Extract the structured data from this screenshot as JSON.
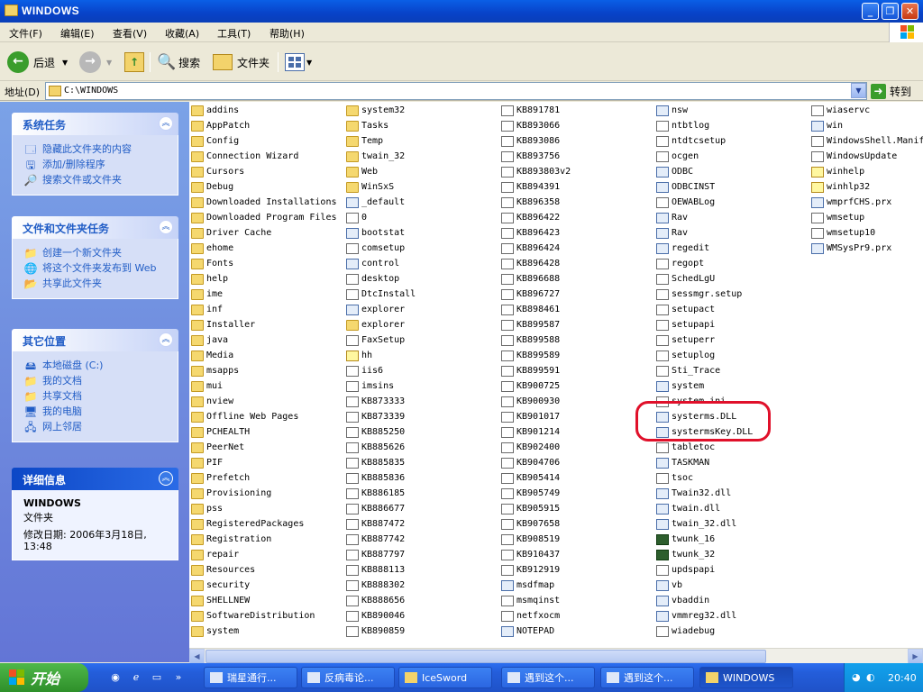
{
  "window": {
    "title": "WINDOWS"
  },
  "menu": [
    "文件(F)",
    "编辑(E)",
    "查看(V)",
    "收藏(A)",
    "工具(T)",
    "帮助(H)"
  ],
  "toolbar": {
    "back": "后退",
    "search": "搜索",
    "folders": "文件夹"
  },
  "address": {
    "label": "地址(D)",
    "value": "C:\\WINDOWS",
    "go": "转到"
  },
  "panels": {
    "system_tasks": {
      "title": "系统任务",
      "items": [
        "隐藏此文件夹的内容",
        "添加/删除程序",
        "搜索文件或文件夹"
      ]
    },
    "file_tasks": {
      "title": "文件和文件夹任务",
      "items": [
        "创建一个新文件夹",
        "将这个文件夹发布到 Web",
        "共享此文件夹"
      ]
    },
    "other_places": {
      "title": "其它位置",
      "items": [
        "本地磁盘 (C:)",
        "我的文档",
        "共享文档",
        "我的电脑",
        "网上邻居"
      ]
    },
    "details": {
      "title": "详细信息",
      "name": "WINDOWS",
      "type": "文件夹",
      "modified": "修改日期: 2006年3月18日, 13:48"
    }
  },
  "files": {
    "col1": [
      {
        "n": "addins",
        "t": "folder"
      },
      {
        "n": "AppPatch",
        "t": "folder"
      },
      {
        "n": "Config",
        "t": "folder"
      },
      {
        "n": "Connection Wizard",
        "t": "folder"
      },
      {
        "n": "Cursors",
        "t": "folder"
      },
      {
        "n": "Debug",
        "t": "folder"
      },
      {
        "n": "Downloaded Installations",
        "t": "folder"
      },
      {
        "n": "Downloaded Program Files",
        "t": "folder"
      },
      {
        "n": "Driver Cache",
        "t": "folder"
      },
      {
        "n": "ehome",
        "t": "folder"
      },
      {
        "n": "Fonts",
        "t": "folder"
      },
      {
        "n": "help",
        "t": "folder"
      },
      {
        "n": "ime",
        "t": "folder"
      },
      {
        "n": "inf",
        "t": "folder"
      },
      {
        "n": "Installer",
        "t": "folder"
      },
      {
        "n": "java",
        "t": "folder"
      },
      {
        "n": "Media",
        "t": "folder"
      },
      {
        "n": "msapps",
        "t": "folder"
      },
      {
        "n": "mui",
        "t": "folder"
      },
      {
        "n": "nview",
        "t": "folder"
      },
      {
        "n": "Offline Web Pages",
        "t": "folder"
      },
      {
        "n": "PCHEALTH",
        "t": "folder"
      },
      {
        "n": "PeerNet",
        "t": "folder"
      },
      {
        "n": "PIF",
        "t": "folder"
      },
      {
        "n": "Prefetch",
        "t": "folder"
      },
      {
        "n": "Provisioning",
        "t": "folder"
      },
      {
        "n": "pss",
        "t": "folder"
      },
      {
        "n": "RegisteredPackages",
        "t": "folder"
      },
      {
        "n": "Registration",
        "t": "folder"
      },
      {
        "n": "repair",
        "t": "folder"
      },
      {
        "n": "Resources",
        "t": "folder"
      },
      {
        "n": "security",
        "t": "folder"
      },
      {
        "n": "SHELLNEW",
        "t": "folder"
      },
      {
        "n": "SoftwareDistribution",
        "t": "folder"
      },
      {
        "n": "system",
        "t": "folder"
      }
    ],
    "col2": [
      {
        "n": "system32",
        "t": "folder"
      },
      {
        "n": "Tasks",
        "t": "folder"
      },
      {
        "n": "Temp",
        "t": "folder"
      },
      {
        "n": "twain_32",
        "t": "folder"
      },
      {
        "n": "Web",
        "t": "folder"
      },
      {
        "n": "WinSxS",
        "t": "folder"
      },
      {
        "n": "_default",
        "t": "exe"
      },
      {
        "n": "0",
        "t": "file"
      },
      {
        "n": "bootstat",
        "t": "exe"
      },
      {
        "n": "comsetup",
        "t": "file"
      },
      {
        "n": "control",
        "t": "exe"
      },
      {
        "n": "desktop",
        "t": "file"
      },
      {
        "n": "DtcInstall",
        "t": "file"
      },
      {
        "n": "explorer",
        "t": "exe"
      },
      {
        "n": "explorer",
        "t": "folder"
      },
      {
        "n": "FaxSetup",
        "t": "file"
      },
      {
        "n": "hh",
        "t": "help"
      },
      {
        "n": "iis6",
        "t": "file"
      },
      {
        "n": "imsins",
        "t": "file"
      },
      {
        "n": "KB873333",
        "t": "file"
      },
      {
        "n": "KB873339",
        "t": "file"
      },
      {
        "n": "KB885250",
        "t": "file"
      },
      {
        "n": "KB885626",
        "t": "file"
      },
      {
        "n": "KB885835",
        "t": "file"
      },
      {
        "n": "KB885836",
        "t": "file"
      },
      {
        "n": "KB886185",
        "t": "file"
      },
      {
        "n": "KB886677",
        "t": "file"
      },
      {
        "n": "KB887472",
        "t": "file"
      },
      {
        "n": "KB887742",
        "t": "file"
      },
      {
        "n": "KB887797",
        "t": "file"
      },
      {
        "n": "KB888113",
        "t": "file"
      },
      {
        "n": "KB888302",
        "t": "file"
      },
      {
        "n": "KB888656",
        "t": "file"
      },
      {
        "n": "KB890046",
        "t": "file"
      },
      {
        "n": "KB890859",
        "t": "file"
      }
    ],
    "col3": [
      {
        "n": "KB891781",
        "t": "file"
      },
      {
        "n": "KB893066",
        "t": "file"
      },
      {
        "n": "KB893086",
        "t": "file"
      },
      {
        "n": "KB893756",
        "t": "file"
      },
      {
        "n": "KB893803v2",
        "t": "file"
      },
      {
        "n": "KB894391",
        "t": "file"
      },
      {
        "n": "KB896358",
        "t": "file"
      },
      {
        "n": "KB896422",
        "t": "file"
      },
      {
        "n": "KB896423",
        "t": "file"
      },
      {
        "n": "KB896424",
        "t": "file"
      },
      {
        "n": "KB896428",
        "t": "file"
      },
      {
        "n": "KB896688",
        "t": "file"
      },
      {
        "n": "KB896727",
        "t": "file"
      },
      {
        "n": "KB898461",
        "t": "file"
      },
      {
        "n": "KB899587",
        "t": "file"
      },
      {
        "n": "KB899588",
        "t": "file"
      },
      {
        "n": "KB899589",
        "t": "file"
      },
      {
        "n": "KB899591",
        "t": "file"
      },
      {
        "n": "KB900725",
        "t": "file"
      },
      {
        "n": "KB900930",
        "t": "file"
      },
      {
        "n": "KB901017",
        "t": "file"
      },
      {
        "n": "KB901214",
        "t": "file"
      },
      {
        "n": "KB902400",
        "t": "file"
      },
      {
        "n": "KB904706",
        "t": "file"
      },
      {
        "n": "KB905414",
        "t": "file"
      },
      {
        "n": "KB905749",
        "t": "file"
      },
      {
        "n": "KB905915",
        "t": "file"
      },
      {
        "n": "KB907658",
        "t": "file"
      },
      {
        "n": "KB908519",
        "t": "file"
      },
      {
        "n": "KB910437",
        "t": "file"
      },
      {
        "n": "KB912919",
        "t": "file"
      },
      {
        "n": "msdfmap",
        "t": "exe"
      },
      {
        "n": "msmqinst",
        "t": "file"
      },
      {
        "n": "netfxocm",
        "t": "file"
      },
      {
        "n": "NOTEPAD",
        "t": "exe"
      }
    ],
    "col4": [
      {
        "n": "nsw",
        "t": "exe"
      },
      {
        "n": "ntbtlog",
        "t": "file"
      },
      {
        "n": "ntdtcsetup",
        "t": "file"
      },
      {
        "n": "ocgen",
        "t": "file"
      },
      {
        "n": "ODBC",
        "t": "exe"
      },
      {
        "n": "ODBCINST",
        "t": "exe"
      },
      {
        "n": "OEWABLog",
        "t": "file"
      },
      {
        "n": "Rav",
        "t": "exe"
      },
      {
        "n": "Rav",
        "t": "exe"
      },
      {
        "n": "regedit",
        "t": "exe"
      },
      {
        "n": "regopt",
        "t": "file"
      },
      {
        "n": "SchedLgU",
        "t": "file"
      },
      {
        "n": "sessmgr.setup",
        "t": "file"
      },
      {
        "n": "setupact",
        "t": "file"
      },
      {
        "n": "setupapi",
        "t": "file"
      },
      {
        "n": "setuperr",
        "t": "file"
      },
      {
        "n": "setuplog",
        "t": "file"
      },
      {
        "n": "Sti_Trace",
        "t": "file"
      },
      {
        "n": "system",
        "t": "exe"
      },
      {
        "n": "system.ini",
        "t": "file"
      },
      {
        "n": "systerms.DLL",
        "t": "exe"
      },
      {
        "n": "systermsKey.DLL",
        "t": "exe"
      },
      {
        "n": "tabletoc",
        "t": "file"
      },
      {
        "n": "TASKMAN",
        "t": "exe"
      },
      {
        "n": "tsoc",
        "t": "file"
      },
      {
        "n": "Twain32.dll",
        "t": "exe"
      },
      {
        "n": "twain.dll",
        "t": "exe"
      },
      {
        "n": "twain_32.dll",
        "t": "exe"
      },
      {
        "n": "twunk_16",
        "t": "app"
      },
      {
        "n": "twunk_32",
        "t": "app"
      },
      {
        "n": "updspapi",
        "t": "file"
      },
      {
        "n": "vb",
        "t": "exe"
      },
      {
        "n": "vbaddin",
        "t": "exe"
      },
      {
        "n": "vmmreg32.dll",
        "t": "exe"
      },
      {
        "n": "wiadebug",
        "t": "file"
      }
    ],
    "col5": [
      {
        "n": "wiaservc",
        "t": "file"
      },
      {
        "n": "win",
        "t": "exe"
      },
      {
        "n": "WindowsShell.Manifest",
        "t": "file"
      },
      {
        "n": "WindowsUpdate",
        "t": "file"
      },
      {
        "n": "winhelp",
        "t": "help"
      },
      {
        "n": "winhlp32",
        "t": "help"
      },
      {
        "n": "wmprfCHS.prx",
        "t": "exe"
      },
      {
        "n": "wmsetup",
        "t": "file"
      },
      {
        "n": "wmsetup10",
        "t": "file"
      },
      {
        "n": "WMSysPr9.prx",
        "t": "exe"
      }
    ]
  },
  "taskbar": {
    "start": "开始",
    "tasks": [
      "瑞星通行...",
      "反病毒论...",
      "IceSword",
      "遇到这个...",
      "遇到这个...",
      "WINDOWS"
    ],
    "clock": "20:40"
  },
  "colors": {
    "highlight": "#e0102a",
    "titlebar": "#0a5fe6",
    "pane": "#7ba2e7"
  }
}
